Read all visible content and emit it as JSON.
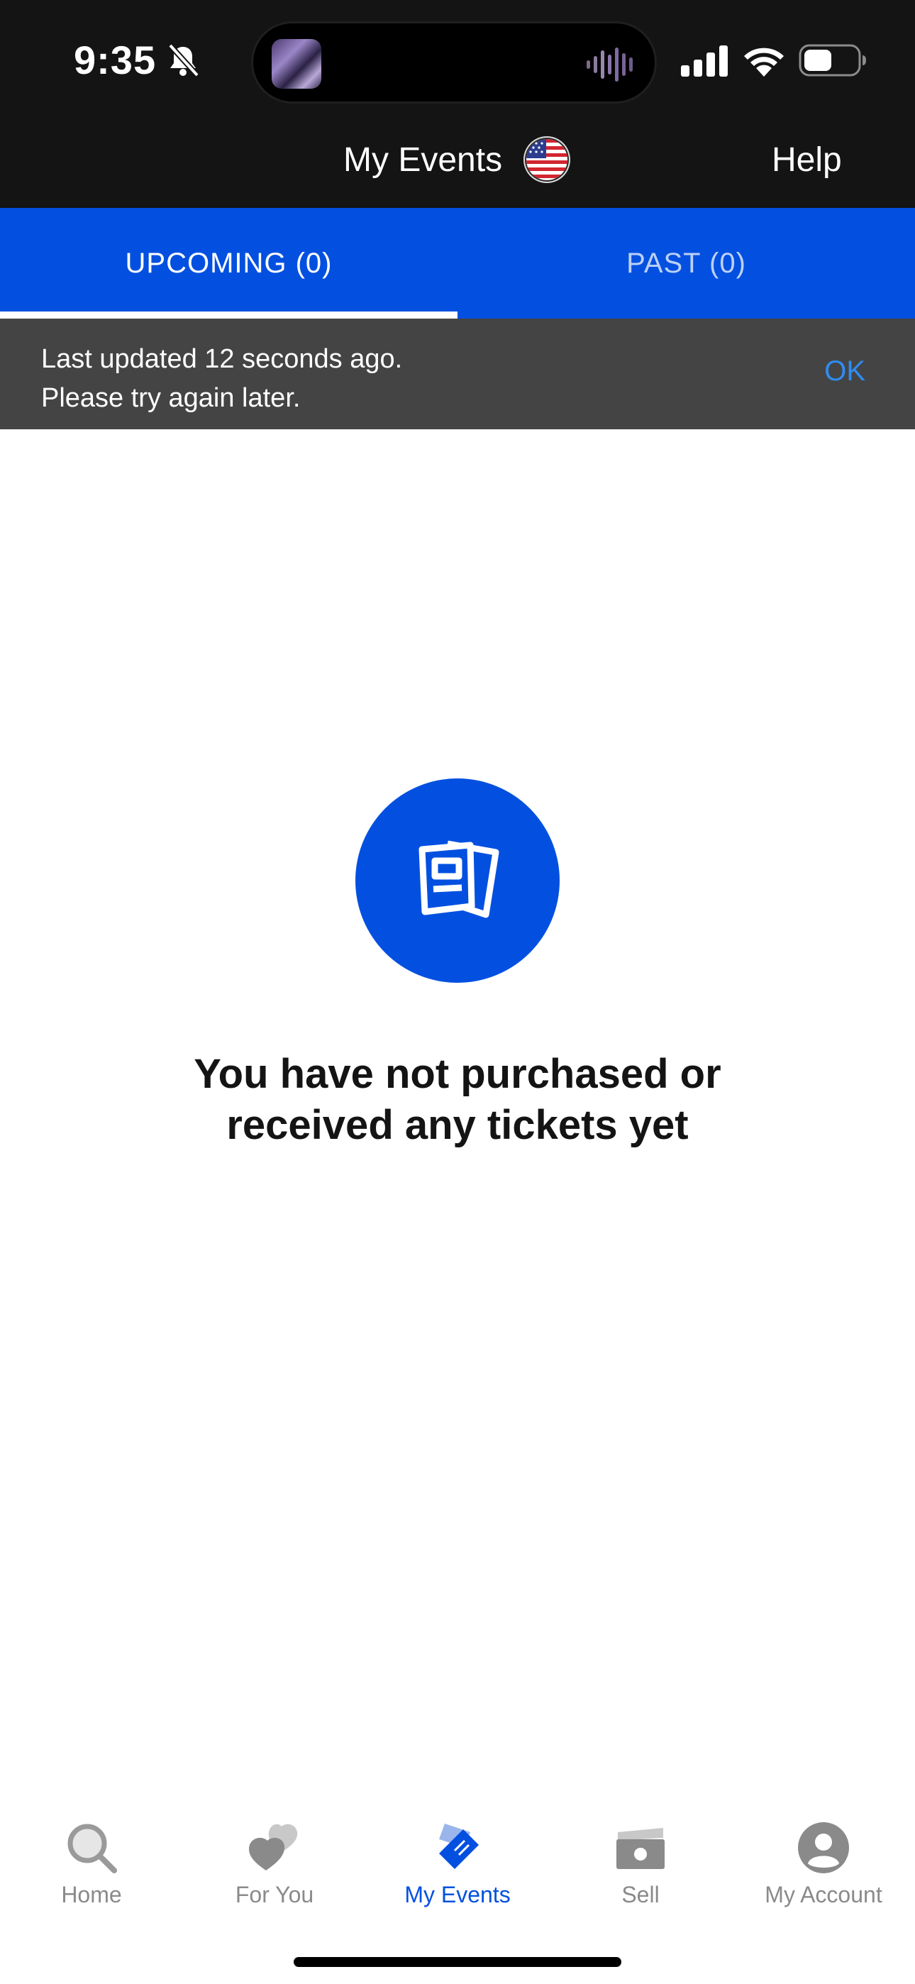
{
  "status_bar": {
    "time": "9:35",
    "icons": [
      "bell-slash-icon",
      "signal-icon",
      "wifi-icon",
      "battery-icon"
    ]
  },
  "header": {
    "title": "My Events",
    "flag_icon": "us-flag-icon",
    "help_label": "Help"
  },
  "tabs": [
    {
      "label": "UPCOMING (0)",
      "active": true
    },
    {
      "label": "PAST (0)",
      "active": false
    }
  ],
  "snackbar": {
    "line1": "Last updated 12 seconds ago.",
    "line2": "Please try again later.",
    "action": "OK"
  },
  "empty_state": {
    "icon": "tickets-icon",
    "line1": "You have not purchased or",
    "line2": "received any tickets yet"
  },
  "bottom_nav": [
    {
      "label": "Home",
      "icon": "search-icon",
      "active": false
    },
    {
      "label": "For You",
      "icon": "hearts-icon",
      "active": false
    },
    {
      "label": "My Events",
      "icon": "ticket-icon",
      "active": true
    },
    {
      "label": "Sell",
      "icon": "cash-icon",
      "active": false
    },
    {
      "label": "My Account",
      "icon": "account-icon",
      "active": false
    }
  ],
  "colors": {
    "brand_blue": "#0350e0",
    "header_bg": "#141414",
    "snackbar_bg": "#444444",
    "snackbar_action": "#2f8cf0",
    "inactive_nav": "#8a8a8a"
  }
}
